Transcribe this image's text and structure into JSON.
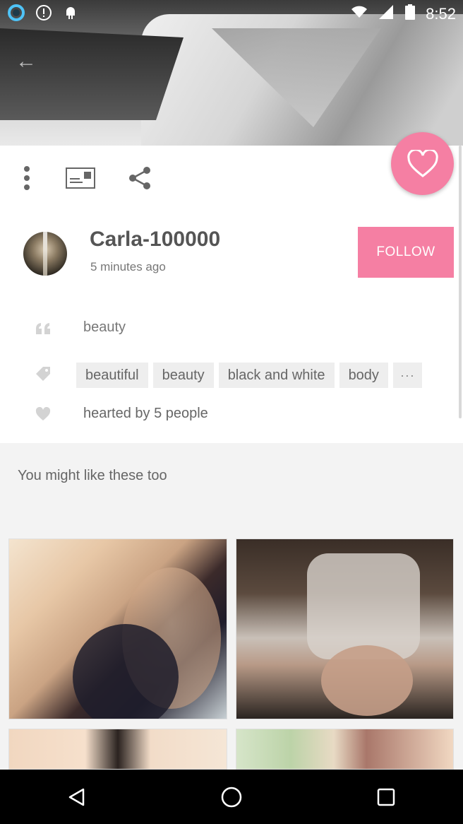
{
  "status_bar": {
    "time": "8:52",
    "left_icons": [
      "app-ring-icon",
      "info-icon",
      "android-icon"
    ],
    "right_icons": [
      "wifi-icon",
      "cellular-signal-icon",
      "battery-icon"
    ]
  },
  "post": {
    "username": "Carla-100000",
    "time_ago": "5 minutes ago",
    "follow_label": "FOLLOW",
    "caption": "beauty",
    "tags": [
      "beautiful",
      "beauty",
      "black and white",
      "body"
    ],
    "more_tags_label": "···",
    "hearted_text": "hearted by 5 people"
  },
  "toolbar": {
    "icons": [
      "more-vert-icon",
      "postcard-icon",
      "share-icon"
    ]
  },
  "suggestions": {
    "title": "You might like these too"
  },
  "nav": {
    "icons": [
      "back-icon",
      "home-icon",
      "recents-icon"
    ]
  },
  "colors": {
    "accent": "#f57fa3",
    "tag_bg": "#eeeeee",
    "suggest_bg": "#f3f3f3"
  }
}
